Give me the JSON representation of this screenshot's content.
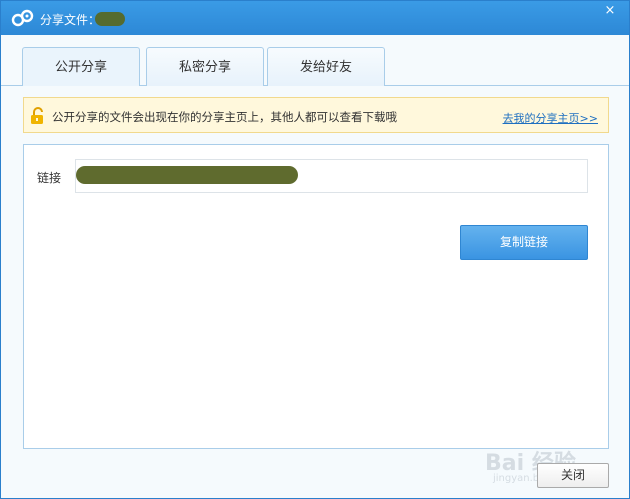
{
  "window": {
    "title": "分享文件：",
    "close_glyph": "×"
  },
  "tabs": [
    {
      "label": "公开分享",
      "active": true
    },
    {
      "label": "私密分享",
      "active": false
    },
    {
      "label": "发给好友",
      "active": false
    }
  ],
  "notice": {
    "text": "公开分享的文件会出现在你的分享主页上，其他人都可以查看下载哦",
    "link": "去我的分享主页>>",
    "icon": "unlock-icon"
  },
  "link_section": {
    "label": "链接",
    "copy_button": "复制链接"
  },
  "footer": {
    "close_button": "关闭"
  },
  "watermark": {
    "text": "Bai 经验",
    "subtext": "jingyan.baidu.com"
  },
  "colors": {
    "titlebar": "#2d88d6",
    "accent": "#3a94e2",
    "notice_bg": "#fff8dc",
    "redaction": "#5f6b2e"
  }
}
